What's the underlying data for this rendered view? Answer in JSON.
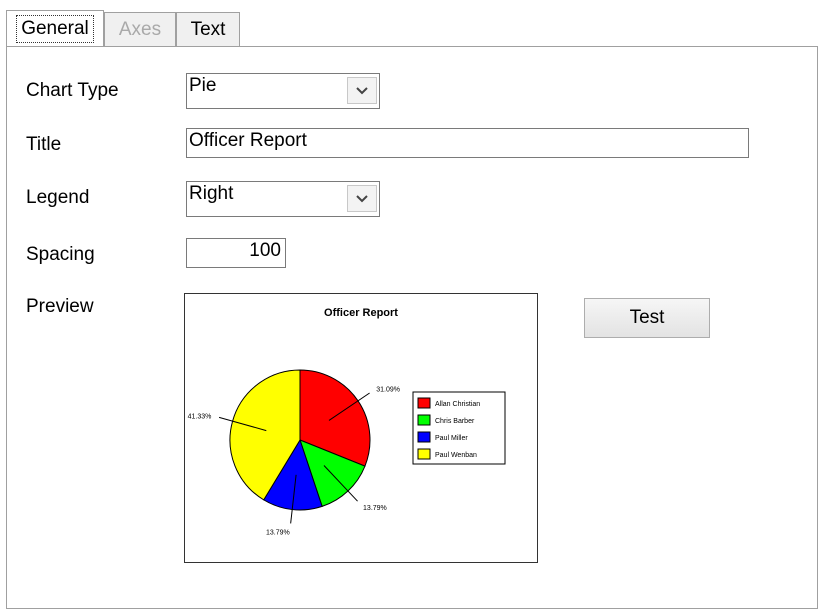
{
  "tabs": [
    {
      "label": "General",
      "selected": true
    },
    {
      "label": "Axes",
      "enabled": false
    },
    {
      "label": "Text"
    }
  ],
  "form": {
    "chart_type": {
      "label": "Chart Type",
      "value": "Pie"
    },
    "title": {
      "label": "Title",
      "value": "Officer Report"
    },
    "legend": {
      "label": "Legend",
      "value": "Right"
    },
    "spacing": {
      "label": "Spacing",
      "value": "100"
    }
  },
  "preview": {
    "label": "Preview"
  },
  "test_button": {
    "label": "Test"
  },
  "icons": {
    "dropdown": "chevron-down-icon"
  },
  "chart_data": {
    "type": "pie",
    "title": "Officer Report",
    "legend_position": "right",
    "slices": [
      {
        "name": "Allan Christian",
        "value": 31.09,
        "label": "31.09%",
        "color": "#ff0000"
      },
      {
        "name": "Chris Barber",
        "value": 13.79,
        "label": "13.79%",
        "color": "#00ff00"
      },
      {
        "name": "Paul Miller",
        "value": 13.79,
        "label": "13.79%",
        "color": "#0000ff"
      },
      {
        "name": "Paul Wenban",
        "value": 41.33,
        "label": "41.33%",
        "color": "#ffff00"
      }
    ]
  }
}
